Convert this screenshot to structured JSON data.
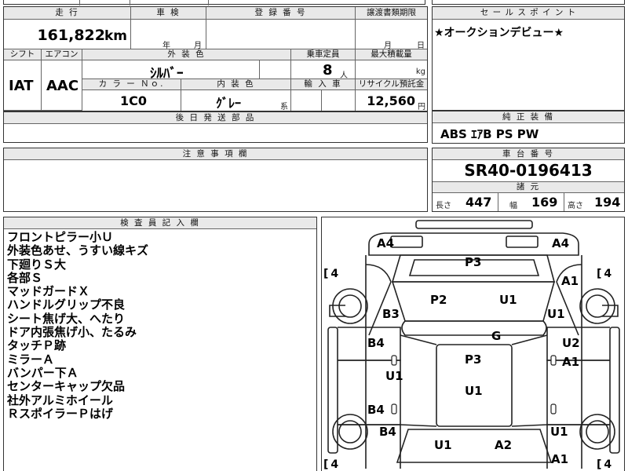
{
  "top_strip": {
    "partial_text": "出品 型式"
  },
  "left_top": {
    "headers": {
      "mileage": "走 行",
      "inspection": "車 検",
      "registration": "登 録 番 号",
      "transfer_deadline": "譲渡書類期限"
    },
    "mileage_value": "161,822",
    "mileage_unit": "km",
    "inspection_year": "年",
    "inspection_month": "月",
    "transfer_month": "月",
    "transfer_day": "日"
  },
  "spec_row": {
    "headers": {
      "shift": "シフト",
      "aircon": "エアコン",
      "ext_color": "外 装 色",
      "capacity": "乗車定員",
      "max_load": "最大積載量",
      "color_no": "カ ラ ー Ｎｏ.",
      "int_color": "内 装 色",
      "import": "輸 入 車",
      "recycle": "リサイクル預託金"
    },
    "shift_value": "IAT",
    "aircon_value": "AAC",
    "ext_color_value": "ｼﾙﾊﾞｰ",
    "capacity_value": "8",
    "capacity_unit": "人",
    "load_unit": "kg",
    "color_no_value": "1C0",
    "int_color_value": "ｸﾞﾚｰ",
    "int_color_suffix": "系",
    "recycle_value": "12,560",
    "recycle_unit": "円"
  },
  "later_parts": {
    "header": "後 日 発 送 部 品"
  },
  "notes": {
    "header": "注 意 事 項 欄"
  },
  "sales_point": {
    "header": "セ ー ル ス ポ イ ン ト",
    "text": "★オークションデビュー★"
  },
  "equipment": {
    "header": "純 正 装 備",
    "value": "ABS ｴｱB PS PW"
  },
  "chassis": {
    "header": "車 台 番 号",
    "value": "SR40-0196413",
    "dims_header": "諸 元",
    "length_label": "長さ",
    "length_value": "447",
    "width_label": "幅",
    "width_value": "169",
    "height_label": "高さ",
    "height_value": "194"
  },
  "inspector": {
    "header": "検 査 員 記 入 欄",
    "remarks": [
      "フロントピラー小Ｕ",
      "外装色あせ、うすい線キズ",
      "下廻りＳ大",
      "各部Ｓ",
      "マッドガードＸ",
      "ハンドルグリップ不良",
      "シート焦げ大、へたり",
      "ドア内張焦げ小、たるみ",
      "タッチＰ跡",
      "ミラーＡ",
      "バンパー下Ａ",
      "センターキャップ欠品",
      "社外アルミホイール",
      "ＲスポイラーＰはげ"
    ]
  },
  "diagram": {
    "labels": {
      "front_left_bumper": "A4",
      "front_right_bumper": "A4",
      "hood": "P3",
      "windshield_left": "P2",
      "windshield_right": "U1",
      "left_front_fender": "B3",
      "right_front_fender_top": "A1",
      "right_front_fender": "U1",
      "roof_front": "G",
      "left_front_door": "B4",
      "right_front_door": "U2",
      "right_front_door_low": "A1",
      "roof": "P3",
      "left_rear_door": "U1",
      "roof_rear": "U1",
      "left_slide": "B4",
      "left_rear_quarter": "B4",
      "right_rear_quarter": "U1",
      "rear_gate_left": "U1",
      "rear_gate_right": "A2",
      "rear_right_corner": "A1"
    },
    "tire_fl": "4",
    "tire_fr": "4",
    "tire_rl": "4",
    "tire_rr": "4"
  }
}
